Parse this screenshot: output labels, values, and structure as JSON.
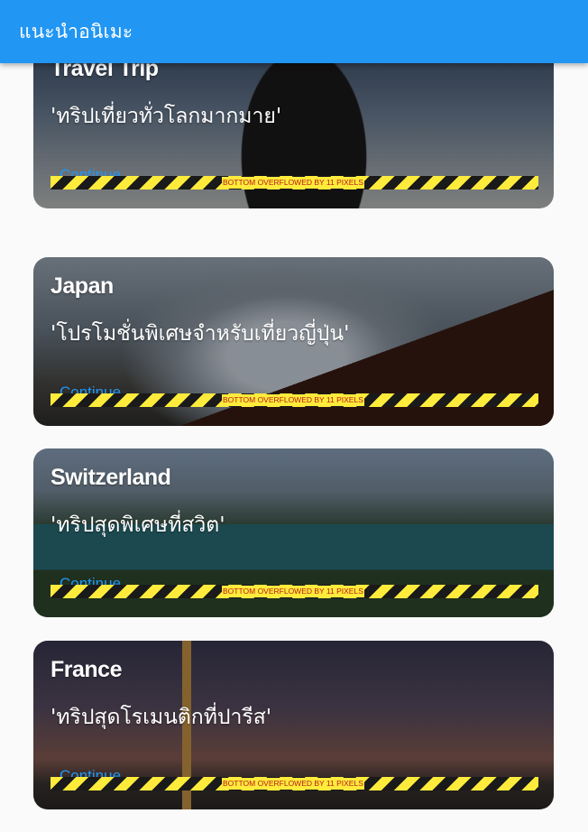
{
  "app_bar": {
    "title": "แนะนำอนิเมะ",
    "color": "#2196f3"
  },
  "cards": [
    {
      "title": "Travel Trip",
      "subtitle": "'ทริปเที่ยวทั่วโลกมากมาย'",
      "action": "Continue",
      "overflow_text": "BOTTOM OVERFLOWED BY 11 PIXELS"
    },
    {
      "title": "Japan",
      "subtitle": "'โปรโมชั่นพิเศษจำหรับเที่ยวญี่ปุ่น'",
      "action": "Continue",
      "overflow_text": "BOTTOM OVERFLOWED BY 11 PIXELS"
    },
    {
      "title": "Switzerland",
      "subtitle": "'ทริปสุดพิเศษที่สวิต'",
      "action": "Continue",
      "overflow_text": "BOTTOM OVERFLOWED BY 11 PIXELS"
    },
    {
      "title": "France",
      "subtitle": "'ทริปสุดโรเมนติกที่ปารีส'",
      "action": "Continue",
      "overflow_text": "BOTTOM OVERFLOWED BY 11 PIXELS"
    }
  ],
  "theme": {
    "accent": "#2196f3",
    "overflow_stripe": "#ffeb3b",
    "overflow_text_color": "#b71c1c"
  }
}
